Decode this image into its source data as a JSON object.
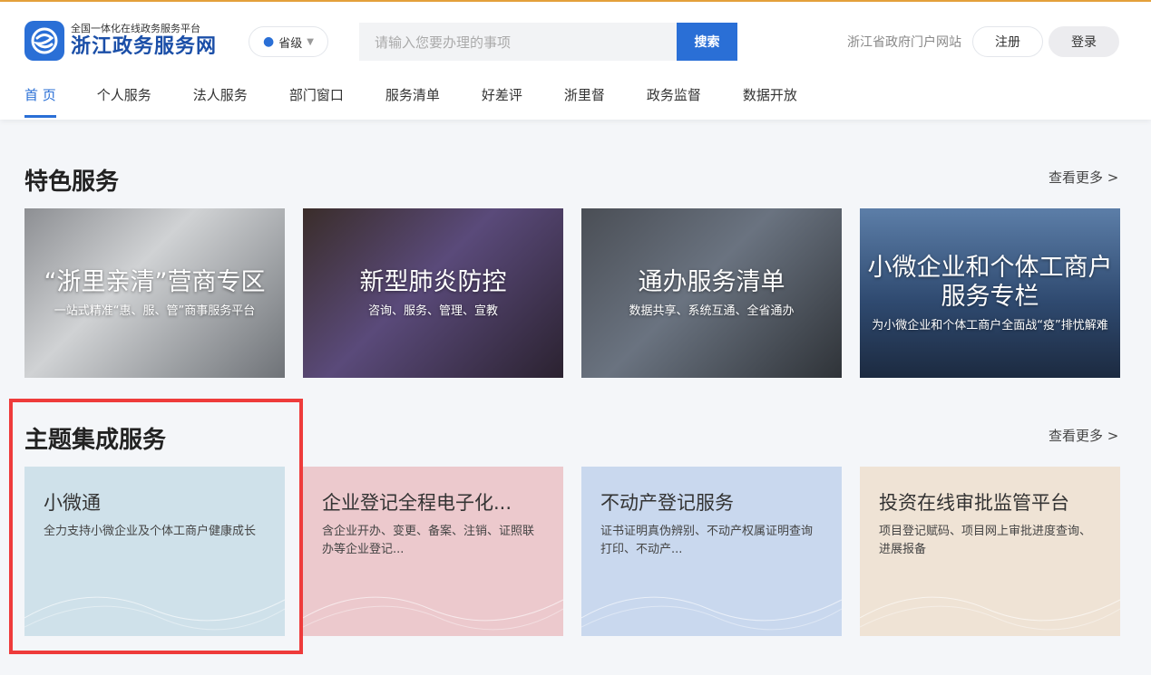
{
  "header": {
    "logo_sub": "全国一体化在线政务服务平台",
    "logo_main": "浙江政务服务网",
    "region": "省级",
    "search_placeholder": "请输入您要办理的事项",
    "search_button": "搜索",
    "portal_link": "浙江省政府门户网站",
    "register": "注册",
    "login": "登录"
  },
  "nav": [
    "首 页",
    "个人服务",
    "法人服务",
    "部门窗口",
    "服务清单",
    "好差评",
    "浙里督",
    "政务监督",
    "数据开放"
  ],
  "featured": {
    "title": "特色服务",
    "more": "查看更多 >",
    "cards": [
      {
        "title": "“浙里亲清”营商专区",
        "subtitle": "一站式精准“惠、服、管”商事服务平台"
      },
      {
        "title": "新型肺炎防控",
        "subtitle": "咨询、服务、管理、宣教"
      },
      {
        "title": "通办服务清单",
        "subtitle": "数据共享、系统互通、全省通办"
      },
      {
        "title": "小微企业和个体工商户服务专栏",
        "subtitle": "为小微企业和个体工商户全面战“疫”排忧解难"
      }
    ]
  },
  "themes": {
    "title": "主题集成服务",
    "more": "查看更多 >",
    "cards": [
      {
        "title": "小微通",
        "desc": "全力支持小微企业及个体工商户健康成长",
        "bg": "#cfe1ea"
      },
      {
        "title": "企业登记全程电子化...",
        "desc": "含企业开办、变更、备案、注销、证照联办等企业登记...",
        "bg": "#ecc9cd"
      },
      {
        "title": "不动产登记服务",
        "desc": "证书证明真伪辨别、不动产权属证明查询打印、不动产...",
        "bg": "#c9d8ee"
      },
      {
        "title": "投资在线审批监管平台",
        "desc": "项目登记赋码、项目网上审批进度查询、进展报备",
        "bg": "#efe3d5"
      }
    ]
  },
  "colors": {
    "primary": "#2a6fd6",
    "highlight": "#ee3b3b"
  }
}
